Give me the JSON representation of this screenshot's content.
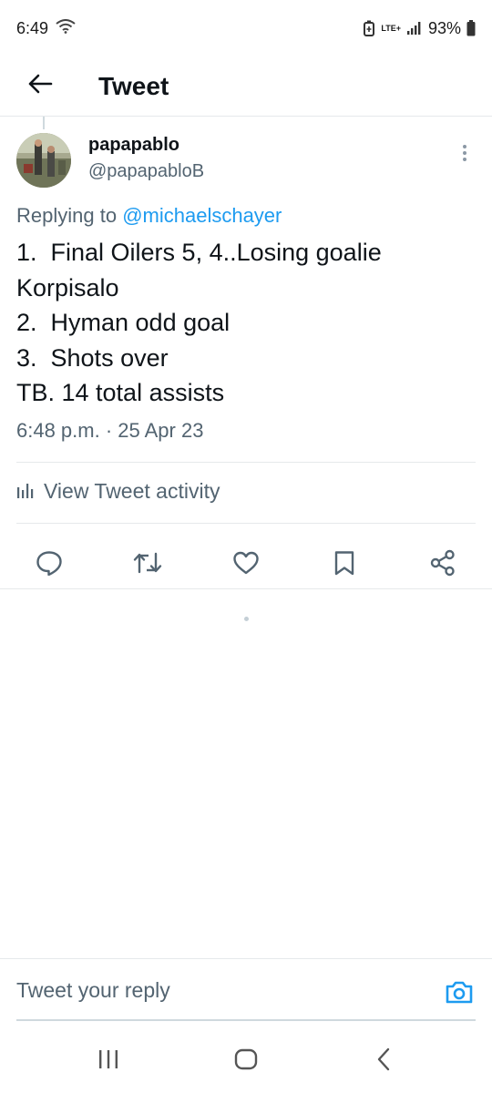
{
  "status_bar": {
    "time": "6:49",
    "network": "LTE+",
    "battery": "93%"
  },
  "header": {
    "title": "Tweet",
    "back_icon": "arrow-left-icon"
  },
  "tweet": {
    "display_name": "papapablo",
    "handle": "@papapabloB",
    "replying_prefix": "Replying to ",
    "replying_to": "@michaelschayer",
    "text": "1.  Final Oilers 5, 4..Losing goalie\nKorpisalo\n2.  Hyman odd goal\n3.  Shots over\nTB. 14 total assists",
    "timestamp": "6:48 p.m. · 25 Apr 23",
    "activity_label": "View Tweet activity"
  },
  "actions": [
    "reply-icon",
    "retweet-icon",
    "like-icon",
    "bookmark-icon",
    "share-icon"
  ],
  "reply_bar": {
    "placeholder": "Tweet your reply"
  },
  "colors": {
    "accent": "#1d9bf0",
    "text": "#0f1419",
    "secondary": "#536471",
    "divider": "#e6e9eb"
  }
}
